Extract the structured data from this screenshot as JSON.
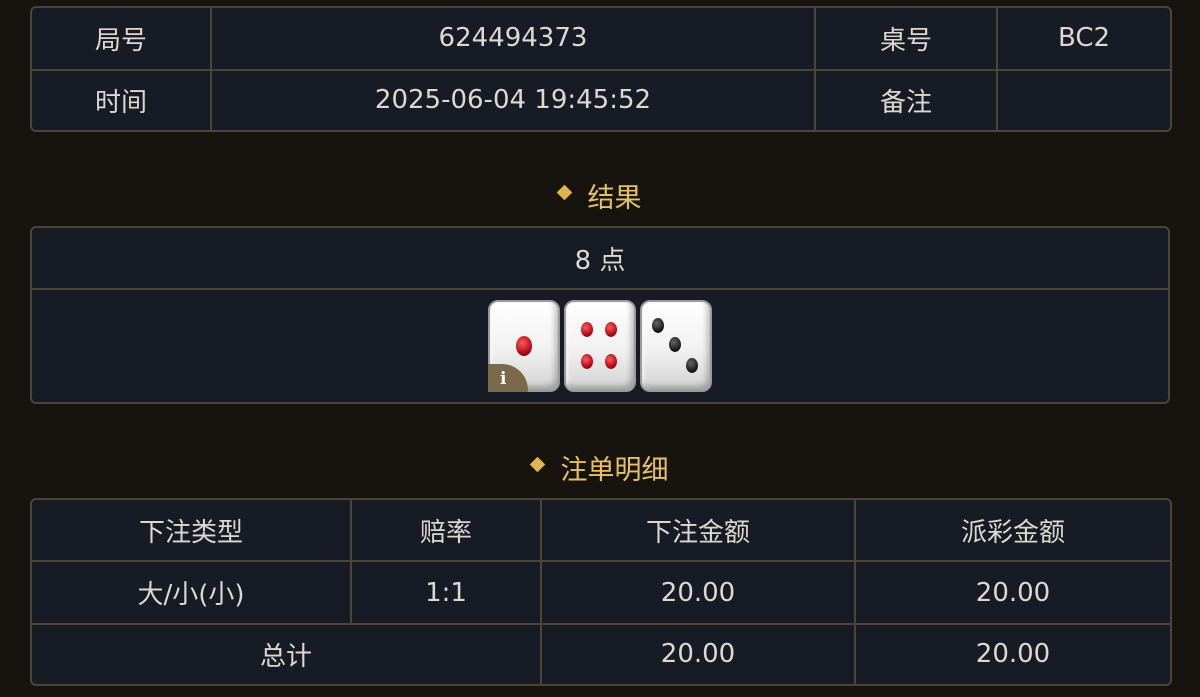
{
  "info": {
    "round_label": "局号",
    "round_value": "624494373",
    "table_label": "桌号",
    "table_value": "BC2",
    "time_label": "时间",
    "time_value": "2025-06-04 19:45:52",
    "remark_label": "备注",
    "remark_value": ""
  },
  "result": {
    "title": "结果",
    "points_text": "8 点",
    "dice": [
      1,
      4,
      3
    ],
    "info_badge": "i"
  },
  "bets": {
    "title": "注单明细",
    "headers": [
      "下注类型",
      "赔率",
      "下注金额",
      "派彩金额"
    ],
    "rows": [
      {
        "type": "大/小(小)",
        "odds": "1:1",
        "bet_amount": "20.00",
        "payout": "20.00"
      }
    ],
    "total_label": "总计",
    "total_bet": "20.00",
    "total_payout": "20.00"
  },
  "colors": {
    "background": "#17140f",
    "panel": "#161b25",
    "border": "#4a4537",
    "accent_gold": "#e7c169",
    "odds_red": "#c61a24"
  }
}
